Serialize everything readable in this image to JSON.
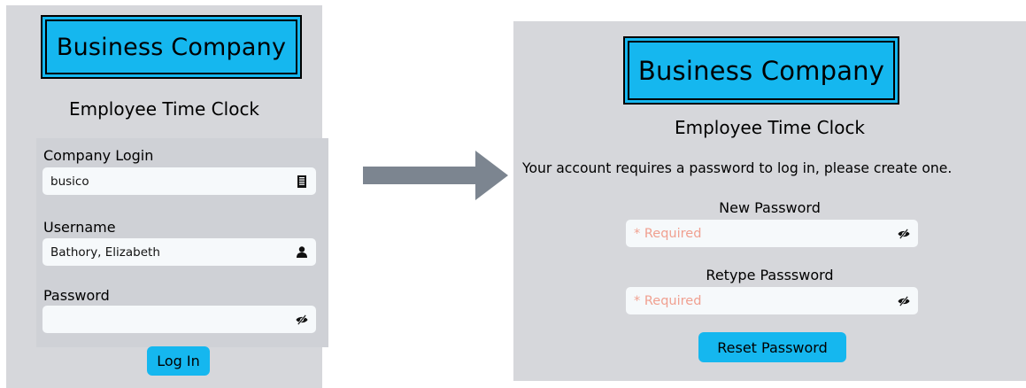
{
  "left": {
    "logo_text": "Business Company",
    "subtitle": "Employee Time Clock",
    "company_login": {
      "label": "Company Login",
      "value": "busico",
      "icon": "building-icon"
    },
    "username": {
      "label": "Username",
      "value": "Bathory, Elizabeth",
      "icon": "user-icon"
    },
    "password": {
      "label": "Password",
      "value": "",
      "icon": "eye-slash-icon"
    },
    "login_button": "Log In"
  },
  "right": {
    "logo_text": "Business Company",
    "subtitle": "Employee Time Clock",
    "message": "Your account requires a password to log in, please create one.",
    "new_password": {
      "label": "New Password",
      "placeholder": "* Required",
      "icon": "eye-slash-icon"
    },
    "retype_password": {
      "label": "Retype Passsword",
      "placeholder": "* Required",
      "icon": "eye-slash-icon"
    },
    "reset_button": "Reset Password"
  },
  "colors": {
    "panel": "#d6d7db",
    "accent": "#15b7ef",
    "arrow": "#7c8590",
    "placeholder": "#f0a090"
  }
}
